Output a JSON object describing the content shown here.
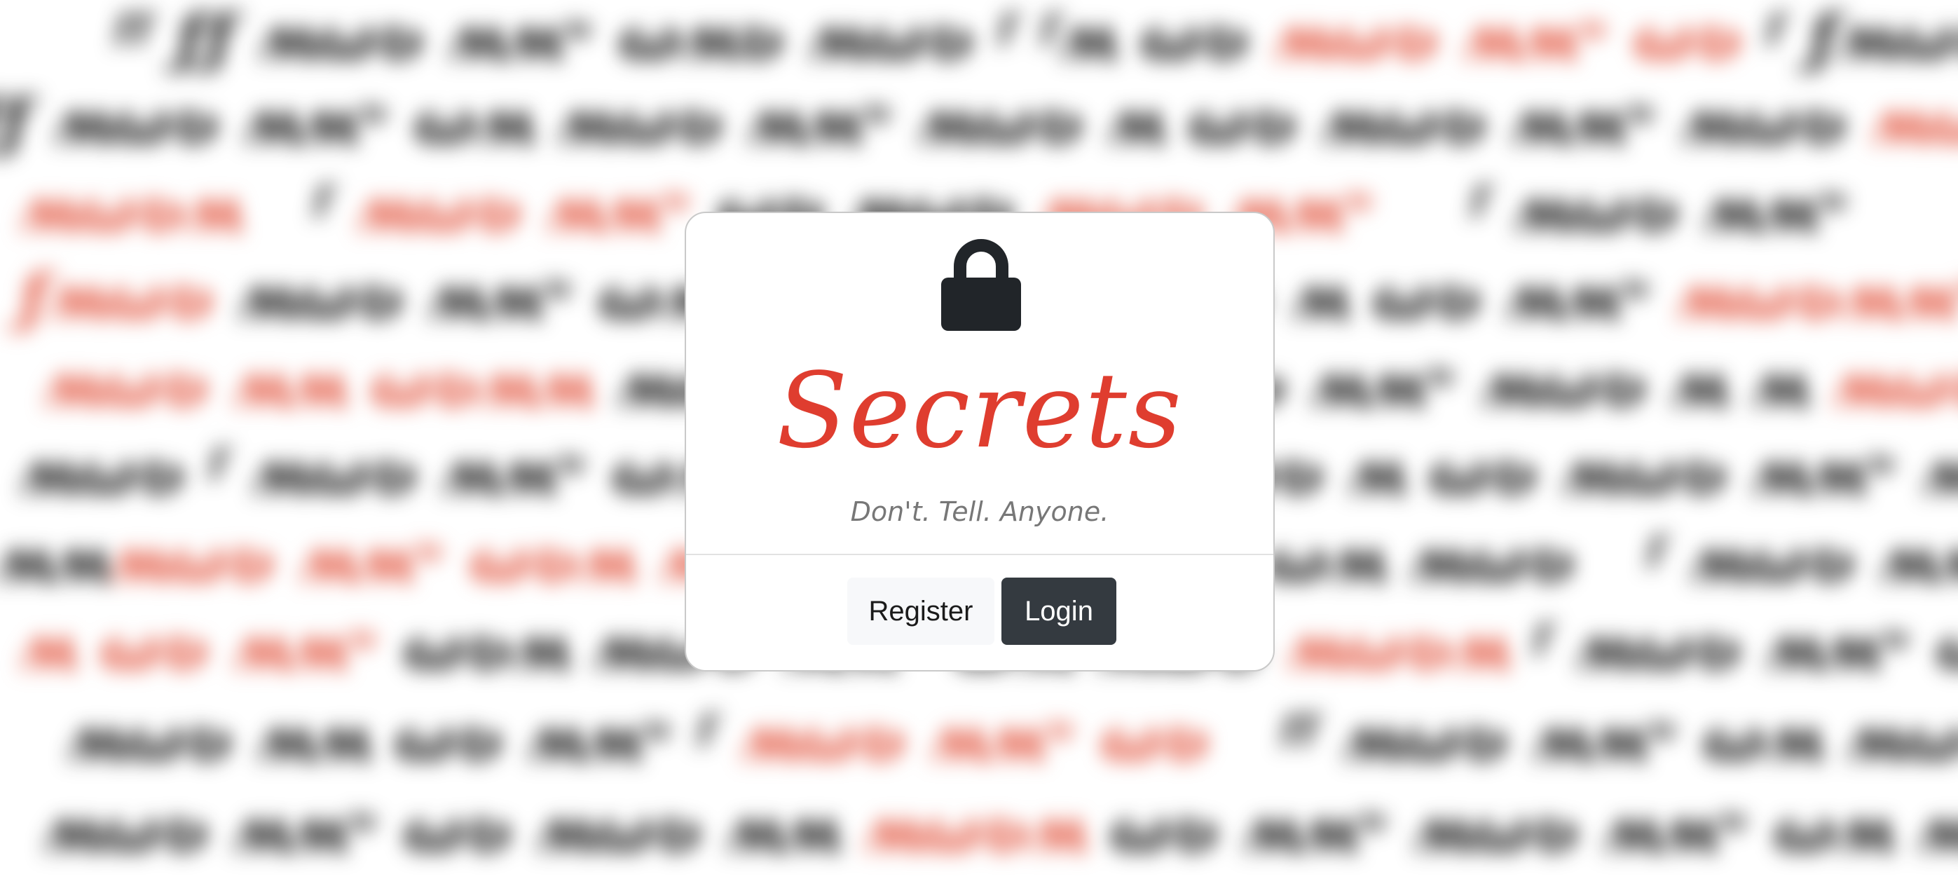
{
  "card": {
    "lock_icon": "lock-icon",
    "title": "Secrets",
    "tagline": "Don't. Tell. Anyone.",
    "buttons": {
      "register": "Register",
      "login": "Login"
    }
  },
  "colors": {
    "title": "#df3d2f",
    "login_bg": "#343a40",
    "register_bg": "#f7f8fa",
    "lock": "#212529"
  }
}
